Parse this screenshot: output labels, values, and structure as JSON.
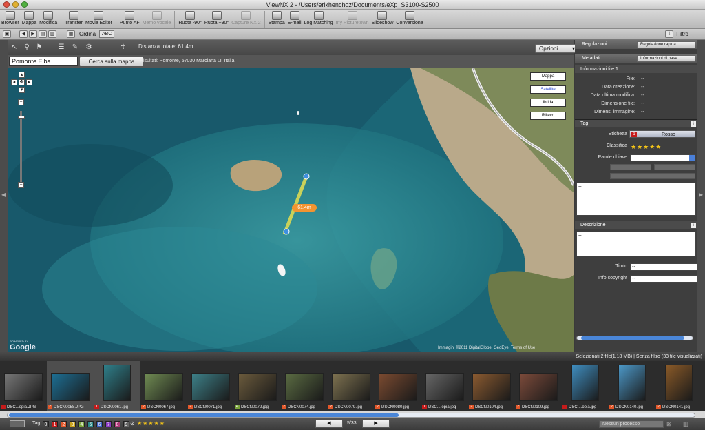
{
  "app": {
    "title": "ViewNX 2 - /Users/erikhenchoz/Documents/eXp_S3100-S2500"
  },
  "colors": {
    "red_label": "#c51b1b",
    "water": "#1d6978",
    "accent_blue": "#4a86d8",
    "distance_label": "#f39431"
  },
  "toolbar": [
    {
      "label": "Browser",
      "icon": "browser-icon",
      "enabled": true
    },
    {
      "label": "Mappa",
      "icon": "map-icon",
      "enabled": true
    },
    {
      "label": "Modifica",
      "icon": "edit-icon",
      "enabled": true
    },
    {
      "label": "Transfer",
      "icon": "transfer-icon",
      "enabled": true
    },
    {
      "label": "Movie Editor",
      "icon": "movie-editor-icon",
      "enabled": true
    },
    {
      "label": "Punto AF",
      "icon": "af-point-icon",
      "enabled": true
    },
    {
      "label": "Memo vocale",
      "icon": "voice-memo-icon",
      "enabled": false
    },
    {
      "label": "Ruota -90°",
      "icon": "rotate-left-icon",
      "enabled": true
    },
    {
      "label": "Ruota +90°",
      "icon": "rotate-right-icon",
      "enabled": true
    },
    {
      "label": "Capture NX 2",
      "icon": "capture-nx-icon",
      "enabled": false
    },
    {
      "label": "Stampa",
      "icon": "print-icon",
      "enabled": true
    },
    {
      "label": "E-mail",
      "icon": "email-icon",
      "enabled": true
    },
    {
      "label": "Log Matching",
      "icon": "log-matching-icon",
      "enabled": true
    },
    {
      "label": "my Picturetown",
      "icon": "picturetown-icon",
      "enabled": false
    },
    {
      "label": "Slideshow",
      "icon": "slideshow-icon",
      "enabled": true
    },
    {
      "label": "Conversione",
      "icon": "conversion-icon",
      "enabled": true
    }
  ],
  "toolbar2": {
    "ordina": "Ordina",
    "abc": "ABC",
    "filtro": "Filtro"
  },
  "maptools": {
    "distanza": "Distanza totale:  61.4m",
    "opzioni": "Opzioni"
  },
  "search": {
    "value": "Pomonte Elba",
    "button": "Cerca sulla mappa",
    "risultati": "Risultati:   Pomonte, 57030 Marciana LI, Italia"
  },
  "map": {
    "types": [
      "Mappa",
      "Satellite",
      "Ibrida",
      "Rilievo"
    ],
    "active_type": "Satellite",
    "distance_label": "61.4m",
    "credit": "Immagini ©2011 DigitalGlobe, GeoEye, Terms of Use",
    "logo": "Google",
    "logo_small": "POWERED BY"
  },
  "rightpanel": {
    "regolazioni": "Regolazioni",
    "regolazioni_select": "Regolazione rapida",
    "metadati": "Metadati",
    "metadati_select": "Informazioni di base",
    "info_title": "Informazioni file 1",
    "info_fields": [
      {
        "label": "File:",
        "value": "--"
      },
      {
        "label": "Data creazione:",
        "value": "--"
      },
      {
        "label": "Data ultima modifica:",
        "value": "--"
      },
      {
        "label": "Dimensione file:",
        "value": "--"
      },
      {
        "label": "Dimens. immagine:",
        "value": "--"
      }
    ],
    "tag_title": "Tag",
    "etichetta_label": "Etichetta",
    "etichetta_num": "1",
    "etichetta_value": "Rosso",
    "classifica_label": "Classifica",
    "stars": "★★★★★",
    "parole_label": "Parole chiave",
    "tag_text": "--",
    "descrizione_title": "Descrizione",
    "desc_text": "--",
    "titolo_label": "Titolo",
    "titolo_value": "--",
    "copyright_label": "Info copyright",
    "copyright_value": "--"
  },
  "filmstrip": {
    "header": "Selezionati:2 file(1,18 MB) | Senza filtro (33 file visualizzati)",
    "items": [
      {
        "num": "1",
        "numcolor": "#c51b1b",
        "name": "DSC...opia.JPG",
        "tone": "#777777",
        "selected": false,
        "tall": false
      },
      {
        "num": "2",
        "numcolor": "#e2572a",
        "name": "DSCN0058.JPG",
        "tone": "#1d6f94",
        "selected": true,
        "tall": false
      },
      {
        "num": "1",
        "numcolor": "#c51b1b",
        "name": "DSCN0061.jpg",
        "tone": "#2f7f8a",
        "selected": true,
        "tall": true
      },
      {
        "num": "2",
        "numcolor": "#e2572a",
        "name": "DSCN0067.jpg",
        "tone": "#6f8a52",
        "selected": false,
        "tall": false
      },
      {
        "num": "2",
        "numcolor": "#e2572a",
        "name": "DSCN0071.jpg",
        "tone": "#3d8088",
        "selected": false,
        "tall": false
      },
      {
        "num": "4",
        "numcolor": "#7aa33a",
        "name": "DSCN0072.jpg",
        "tone": "#6a5a3c",
        "selected": false,
        "tall": false
      },
      {
        "num": "2",
        "numcolor": "#e2572a",
        "name": "DSCN0074.jpg",
        "tone": "#5a6b42",
        "selected": false,
        "tall": false
      },
      {
        "num": "2",
        "numcolor": "#e2572a",
        "name": "DSCN0079.jpg",
        "tone": "#7e7250",
        "selected": false,
        "tall": false
      },
      {
        "num": "2",
        "numcolor": "#e2572a",
        "name": "DSCN0080.jpg",
        "tone": "#7a4a30",
        "selected": false,
        "tall": false
      },
      {
        "num": "1",
        "numcolor": "#c51b1b",
        "name": "DSC....opia.jpg",
        "tone": "#666666",
        "selected": false,
        "tall": false
      },
      {
        "num": "2",
        "numcolor": "#e2572a",
        "name": "DSCN0104.jpg",
        "tone": "#8a5a30",
        "selected": false,
        "tall": false
      },
      {
        "num": "2",
        "numcolor": "#e2572a",
        "name": "DSCN0109.jpg",
        "tone": "#7b4a3a",
        "selected": false,
        "tall": false
      },
      {
        "num": "1",
        "numcolor": "#c51b1b",
        "name": "DSC....opia.jpg",
        "tone": "#3f8dbf",
        "selected": false,
        "tall": true
      },
      {
        "num": "2",
        "numcolor": "#e2572a",
        "name": "DSCN0140.jpg",
        "tone": "#4c98c8",
        "selected": false,
        "tall": true
      },
      {
        "num": "2",
        "numcolor": "#e2572a",
        "name": "DSCN0141.jpg",
        "tone": "#8a5a28",
        "selected": false,
        "tall": true
      }
    ]
  },
  "status": {
    "tag": "Tag",
    "tagnums": [
      {
        "n": "0",
        "c": "#444444"
      },
      {
        "n": "1",
        "c": "#c51b1b"
      },
      {
        "n": "2",
        "c": "#e2572a"
      },
      {
        "n": "3",
        "c": "#c9a21b"
      },
      {
        "n": "4",
        "c": "#7aa33a"
      },
      {
        "n": "5",
        "c": "#2b8a8a"
      },
      {
        "n": "6",
        "c": "#3a5fc4"
      },
      {
        "n": "7",
        "c": "#8a3ac4"
      },
      {
        "n": "8",
        "c": "#b03a7a"
      },
      {
        "n": "9",
        "c": "#666666"
      }
    ],
    "stars": "★★★★★",
    "page": "5/33",
    "nessun": "Nessun processo"
  }
}
